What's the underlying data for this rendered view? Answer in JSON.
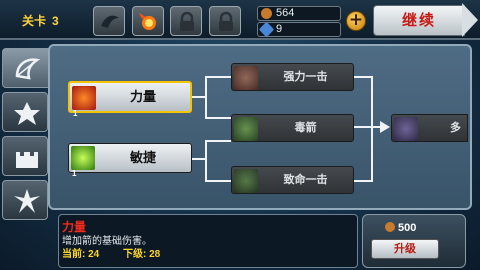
{
  "topbar": {
    "level_label": "关卡",
    "level_value": "3",
    "slots": [
      "bird-icon",
      "fireball-icon",
      "lock-icon",
      "lock-icon"
    ],
    "coins": "564",
    "gems": "9",
    "plus_label": "+",
    "continue_label": "继续"
  },
  "tabs": [
    "bow-tab-icon",
    "star-tab-icon",
    "castle-tab-icon",
    "weapon-tab-icon"
  ],
  "tree": {
    "power": {
      "label": "力量",
      "level": "1"
    },
    "agility": {
      "label": "敏捷",
      "level": "1"
    },
    "strike": {
      "label": "强力一击"
    },
    "poison": {
      "label": "毒箭"
    },
    "crit": {
      "label": "致命一击"
    },
    "multi": {
      "label": "多"
    }
  },
  "desc": {
    "title": "力量",
    "text": "增加箭的基础伤害。",
    "current_label": "当前: 24",
    "next_label": "下级: 28"
  },
  "upgrade": {
    "cost": "500",
    "button_label": "升级"
  },
  "colors": {
    "accent_yellow": "#f5c400",
    "red_text": "#ee2b1c"
  }
}
